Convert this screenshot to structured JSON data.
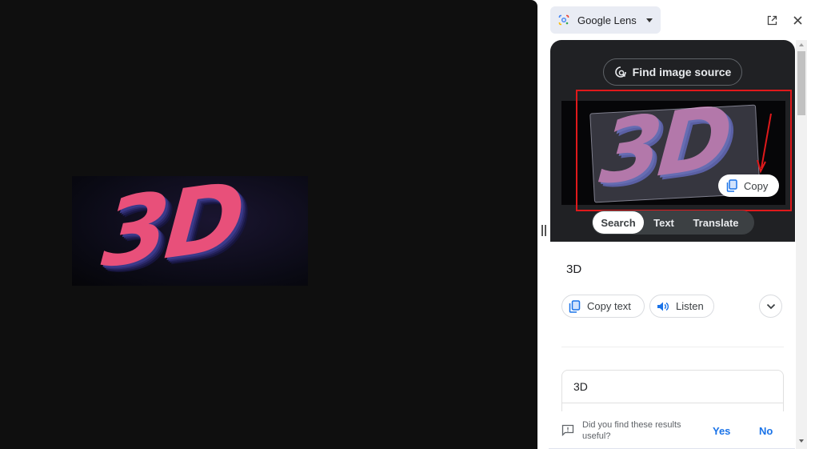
{
  "viewer": {
    "image_text": "3D"
  },
  "header": {
    "title": "Google Lens",
    "open_in_new_tab_icon": "open-in-new-icon",
    "close_icon": "close-icon"
  },
  "lens": {
    "find_source_label": "Find image source",
    "copy_chip_label": "Copy",
    "preview_text": "3D",
    "tabs": [
      {
        "label": "Search",
        "active": true
      },
      {
        "label": "Text",
        "active": false
      },
      {
        "label": "Translate",
        "active": false
      }
    ]
  },
  "result": {
    "detected_text": "3D",
    "copy_text_label": "Copy text",
    "listen_label": "Listen",
    "text_card_value": "3D"
  },
  "feedback": {
    "question": "Did you find these results useful?",
    "yes_label": "Yes",
    "no_label": "No"
  },
  "colors": {
    "accent_blue": "#1a73e8",
    "annotation_red": "#e0191b",
    "lens_card_bg": "#202124"
  }
}
